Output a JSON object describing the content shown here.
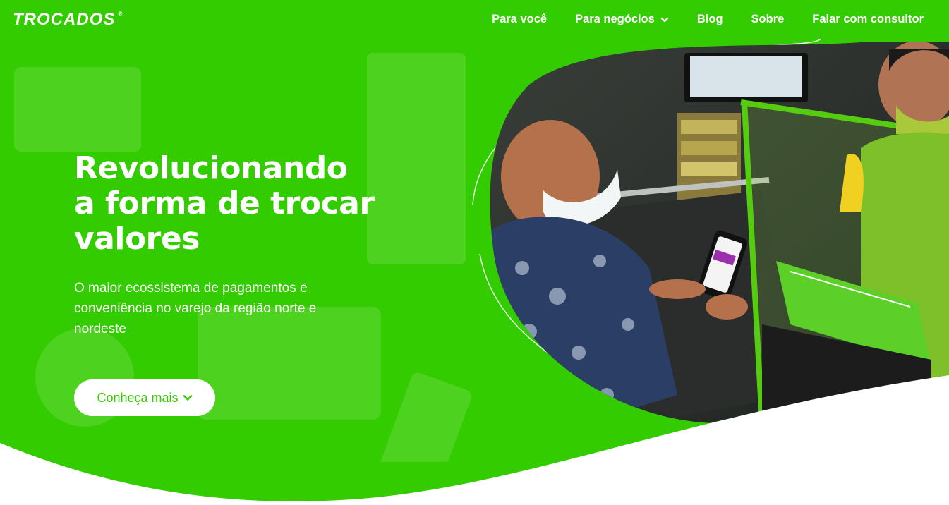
{
  "brand": {
    "logo_text": "TROCADOS",
    "registered": "®",
    "primary_color": "#33cc00"
  },
  "nav": {
    "items": [
      {
        "label": "Para você",
        "has_dropdown": false
      },
      {
        "label": "Para negócios",
        "has_dropdown": true
      },
      {
        "label": "Blog",
        "has_dropdown": false
      },
      {
        "label": "Sobre",
        "has_dropdown": false
      },
      {
        "label": "Falar com consultor",
        "has_dropdown": false
      }
    ]
  },
  "hero": {
    "title_line1": "Revolucionando",
    "title_line2": "a forma de trocar",
    "title_line3": "valores",
    "subtitle": "O maior ecossistema de pagamentos e conveniência no varejo da região norte e nordeste",
    "cta_label": "Conheça mais",
    "photo_alt_icon": "checkout-photo"
  }
}
